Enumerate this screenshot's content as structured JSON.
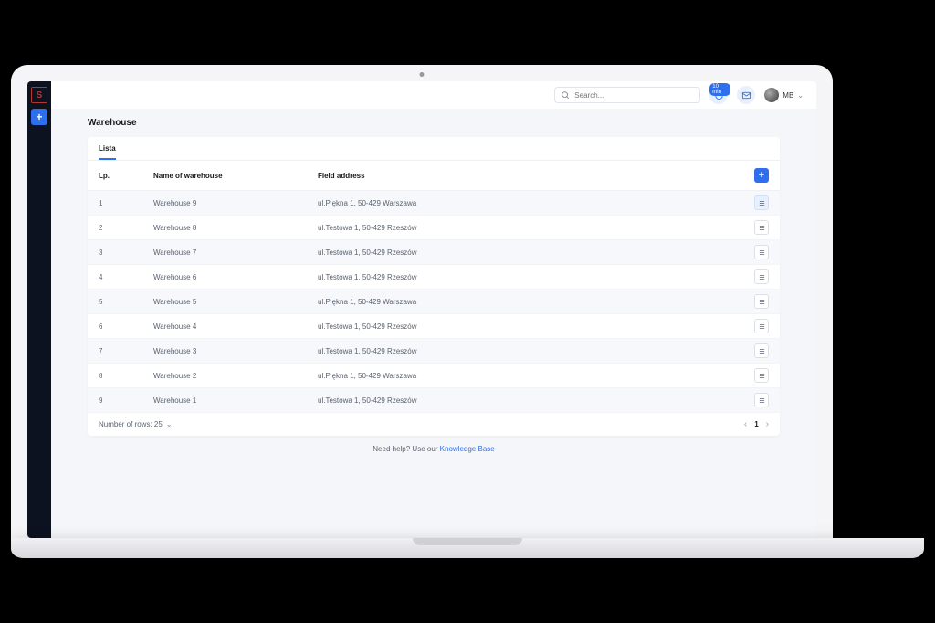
{
  "topbar": {
    "search_placeholder": "Search...",
    "notif_badge": "10 min",
    "user_initials": "MB"
  },
  "page_title": "Warehouse",
  "tabs": [
    {
      "label": "Lista"
    }
  ],
  "columns": {
    "lp": "Lp.",
    "name": "Name of warehouse",
    "address": "Field address"
  },
  "rows": [
    {
      "lp": "1",
      "name": "Warehouse 9",
      "address": "ul.Piękna 1, 50-429 Warszawa",
      "highlight": true
    },
    {
      "lp": "2",
      "name": "Warehouse 8",
      "address": "ul.Testowa 1, 50-429 Rzeszów",
      "highlight": false
    },
    {
      "lp": "3",
      "name": "Warehouse 7",
      "address": "ul.Testowa 1, 50-429 Rzeszów",
      "highlight": false
    },
    {
      "lp": "4",
      "name": "Warehouse 6",
      "address": "ul.Testowa 1, 50-429 Rzeszów",
      "highlight": false
    },
    {
      "lp": "5",
      "name": "Warehouse 5",
      "address": "ul.Piękna 1, 50-429 Warszawa",
      "highlight": false
    },
    {
      "lp": "6",
      "name": "Warehouse 4",
      "address": "ul.Testowa 1, 50-429 Rzeszów",
      "highlight": false
    },
    {
      "lp": "7",
      "name": "Warehouse 3",
      "address": "ul.Testowa 1, 50-429 Rzeszów",
      "highlight": false
    },
    {
      "lp": "8",
      "name": "Warehouse 2",
      "address": "ul.Piękna 1, 50-429 Warszawa",
      "highlight": false
    },
    {
      "lp": "9",
      "name": "Warehouse 1",
      "address": "ul.Testowa 1, 50-429 Rzeszów",
      "highlight": false
    }
  ],
  "footer": {
    "rows_label": "Number of rows: 25",
    "page": "1"
  },
  "help": {
    "prefix": "Need help? Use our ",
    "link": "Knowledge Base"
  }
}
